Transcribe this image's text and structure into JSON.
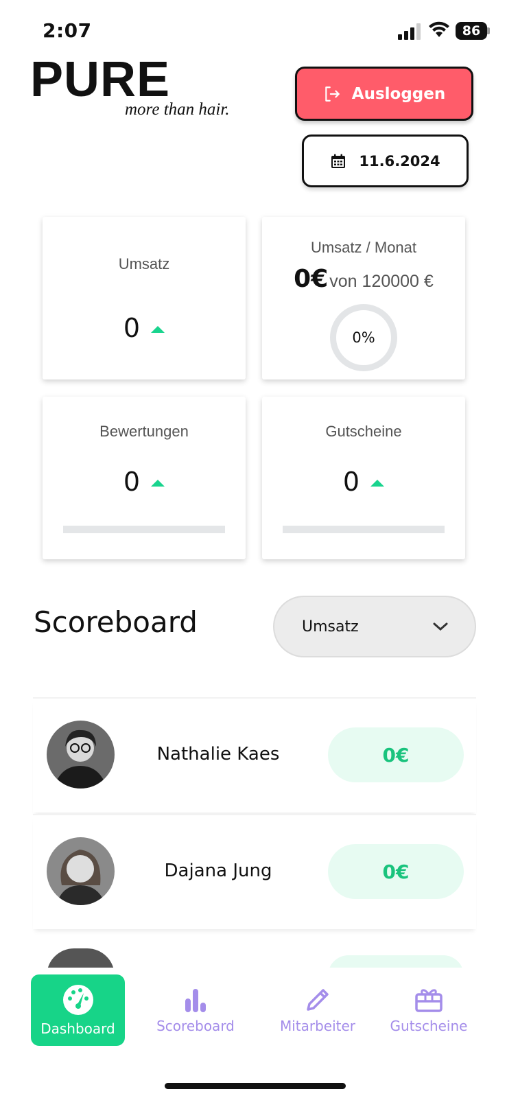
{
  "status": {
    "time": "2:07",
    "battery": "86"
  },
  "brand": {
    "logo": "PURE",
    "tagline": "more than hair."
  },
  "header": {
    "logout_label": "Ausloggen",
    "date": "11.6.2024"
  },
  "stats": {
    "umsatz": {
      "title": "Umsatz",
      "value": "0"
    },
    "monat": {
      "title": "Umsatz / Monat",
      "value": "0€",
      "of_label": "von 120000 €",
      "percent_label": "0%",
      "progress": 0
    },
    "bewertungen": {
      "title": "Bewertungen",
      "value": "0",
      "progress": 0
    },
    "gutscheine": {
      "title": "Gutscheine",
      "value": "0",
      "progress": 0
    }
  },
  "scoreboard": {
    "title": "Scoreboard",
    "filter_value": "Umsatz",
    "rows": [
      {
        "name": "Nathalie Kaes",
        "value": "0€"
      },
      {
        "name": "Dajana Jung",
        "value": "0€"
      }
    ]
  },
  "nav": {
    "items": [
      {
        "label": "Dashboard",
        "icon": "dashboard-icon",
        "active": true
      },
      {
        "label": "Scoreboard",
        "icon": "bar-chart-icon",
        "active": false
      },
      {
        "label": "Mitarbeiter",
        "icon": "pencil-icon",
        "active": false
      },
      {
        "label": "Gutscheine",
        "icon": "gift-icon",
        "active": false
      }
    ]
  },
  "colors": {
    "accent_green": "#17d488",
    "logout_red": "#ff5c6a",
    "nav_inactive": "#a48dea"
  }
}
